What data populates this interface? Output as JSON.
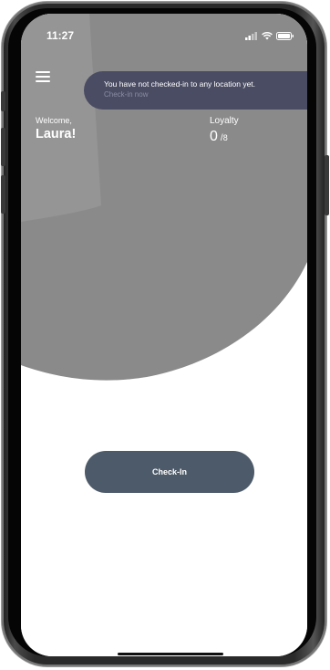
{
  "status_bar": {
    "time": "11:27",
    "icons": [
      "signal-icon",
      "wifi-icon",
      "battery-icon"
    ]
  },
  "header": {
    "menu_icon": "hamburger-menu-icon"
  },
  "notification": {
    "message": "You have not checked-in to any location yet.",
    "action": "Check-in now"
  },
  "welcome": {
    "label": "Welcome,",
    "name": "Laura!"
  },
  "loyalty": {
    "label": "Loyalty",
    "current": "0",
    "separator": "/",
    "total": "8"
  },
  "checkin_button": {
    "label": "Check-In"
  },
  "colors": {
    "header_background": "#8a8a8a",
    "notification_background": "#4a4c63",
    "button_background": "#4d5a69",
    "page_background": "#ffffff"
  }
}
